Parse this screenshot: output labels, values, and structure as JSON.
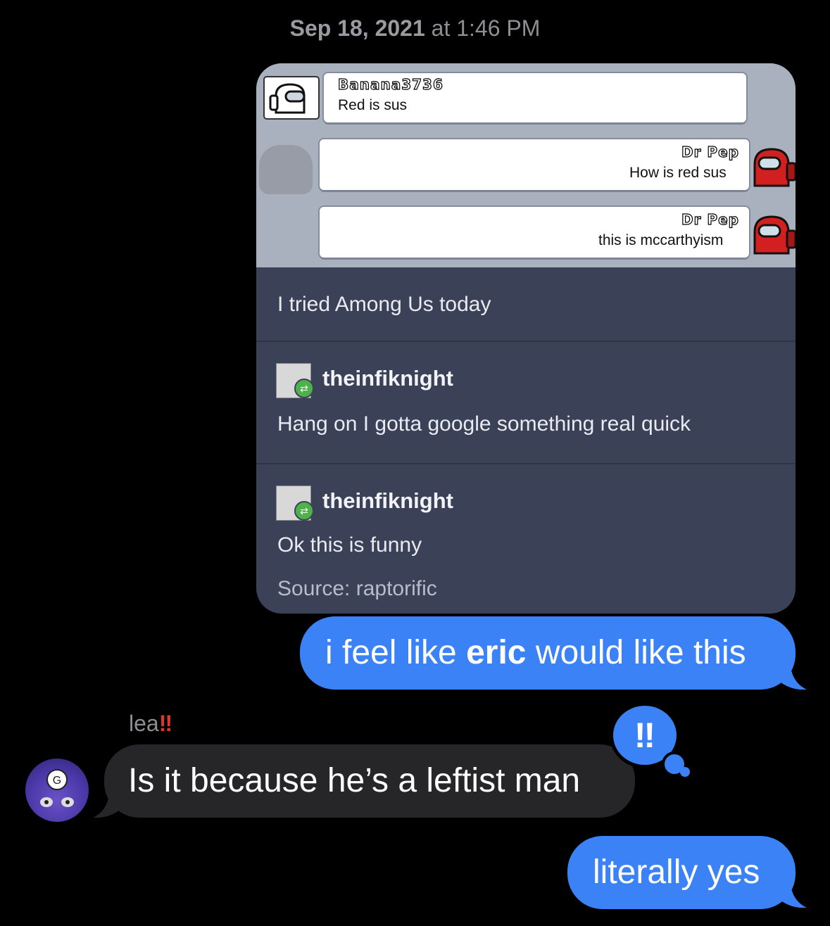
{
  "timestamp": {
    "date": "Sep 18, 2021",
    "time": "at 1:46 PM"
  },
  "shared_image": {
    "game_chat": [
      {
        "name": "Banana3736",
        "message": "Red is sus"
      },
      {
        "name": "Dr Pep",
        "message": "How is red sus"
      },
      {
        "name": "Dr Pep",
        "message": "this is mccarthyism"
      }
    ],
    "post_text": "I tried Among Us today",
    "reblogs": [
      {
        "user": "theinfiknight",
        "text": "Hang on I gotta google something real quick"
      },
      {
        "user": "theinfiknight",
        "text": "Ok this is funny"
      }
    ],
    "source": "Source: raptorific"
  },
  "messages": {
    "out1": {
      "before": "i feel like ",
      "bold": "eric",
      "after": " would like this"
    },
    "sender": {
      "name": "lea",
      "emoji": "‼"
    },
    "in1": "Is it because he’s a leftist man",
    "tapback": "‼",
    "out2": "literally yes"
  },
  "colors": {
    "outgoing": "#3b82f6",
    "incoming": "#262628",
    "background": "#000000"
  }
}
